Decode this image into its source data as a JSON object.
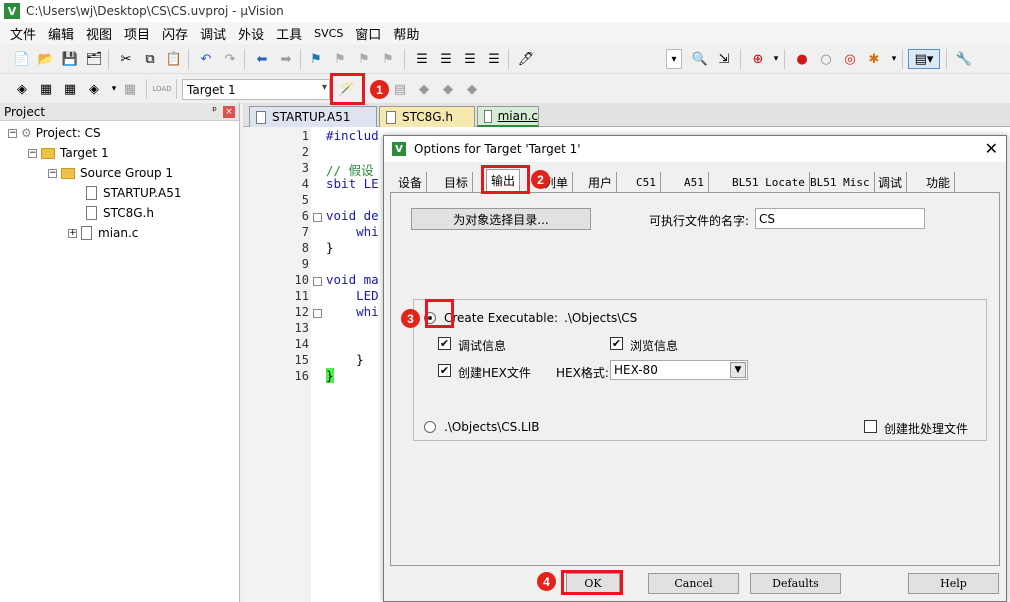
{
  "window": {
    "title": "C:\\Users\\wj\\Desktop\\CS\\CS.uvproj - µVision",
    "icon_letter": "V"
  },
  "menu": [
    "文件",
    "编辑",
    "视图",
    "项目",
    "闪存",
    "调试",
    "外设",
    "工具",
    "SVCS",
    "窗口",
    "帮助"
  ],
  "toolbar2": {
    "target": "Target 1"
  },
  "project": {
    "header": "Project",
    "pin": "ᵖ",
    "close": "×",
    "tree": {
      "root": "Project: CS",
      "target": "Target 1",
      "group": "Source Group 1",
      "files": [
        "STARTUP.A51",
        "STC8G.h",
        "mian.c"
      ]
    }
  },
  "editor": {
    "tabs": [
      "STARTUP.A51",
      "STC8G.h",
      "mian.c"
    ],
    "active_tab": "mian.c",
    "line_numbers": [
      "1",
      "2",
      "3",
      "4",
      "5",
      "6",
      "7",
      "8",
      "9",
      "10",
      "11",
      "12",
      "13",
      "14",
      "15",
      "16"
    ],
    "lines": [
      {
        "n": 1,
        "text": "#includ"
      },
      {
        "n": 3,
        "text": "// 假设"
      },
      {
        "n": 4,
        "text": "sbit LE"
      },
      {
        "n": 6,
        "text": "void de"
      },
      {
        "n": 7,
        "text": "    whi"
      },
      {
        "n": 8,
        "text": "}"
      },
      {
        "n": 10,
        "text": "void ma"
      },
      {
        "n": 11,
        "text": "    LED"
      },
      {
        "n": 12,
        "text": "    whi"
      },
      {
        "n": 15,
        "text": "    }"
      },
      {
        "n": 16,
        "text": "}"
      }
    ]
  },
  "dialog": {
    "title": "Options for Target 'Target 1'",
    "close": "✕",
    "tabs": [
      "设备",
      "目标",
      "输出",
      "列单",
      "用户",
      "C51",
      "A51",
      "BL51 Locate",
      "BL51 Misc",
      "调试",
      "功能"
    ],
    "active_tab": "输出",
    "select_folder_button": "为对象选择目录...",
    "exe_name_label": "可执行文件的名字:",
    "exe_name_value": "CS",
    "create_executable_label": "Create Executable:",
    "create_executable_path": ".\\Objects\\CS",
    "debug_info_label": "调试信息",
    "debug_info_checked": true,
    "browse_info_label": "浏览信息",
    "browse_info_checked": true,
    "create_hex_label": "创建HEX文件",
    "create_hex_checked": true,
    "hex_format_label": "HEX格式:",
    "hex_format_value": "HEX-80",
    "lib_path": ".\\Objects\\CS.LIB",
    "batch_file_label": "创建批处理文件",
    "batch_file_checked": false,
    "buttons": {
      "ok": "OK",
      "cancel": "Cancel",
      "defaults": "Defaults",
      "help": "Help"
    }
  },
  "annotations": [
    "1",
    "2",
    "3",
    "4"
  ],
  "colors": {
    "highlight": "#e8171f",
    "badge": "#e2231a",
    "comment": "#2e8b3a",
    "keyword": "#1a1aa6"
  }
}
